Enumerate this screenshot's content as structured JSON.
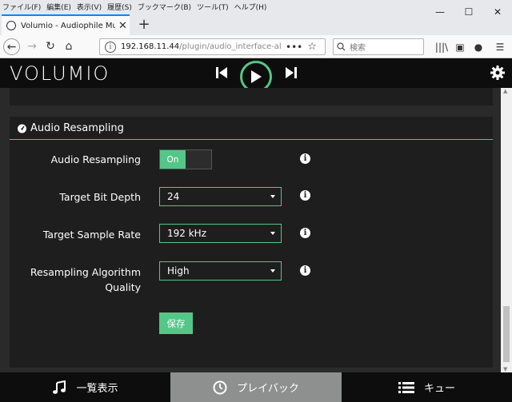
{
  "browser": {
    "menu": [
      "ファイル(F)",
      "編集(E)",
      "表示(V)",
      "履歴(S)",
      "ブックマーク(B)",
      "ツール(T)",
      "ヘルプ(H)"
    ],
    "tab_title": "Volumio - Audiophile Music Pla",
    "url_host": "192.168.11.44",
    "url_path": "/plugin/audio_interface-als",
    "search_placeholder": "検索"
  },
  "app": {
    "logo": "VOLUMIO"
  },
  "section": {
    "title": "Audio Resampling",
    "rows": {
      "resampling_label": "Audio Resampling",
      "resampling_state": "On",
      "bit_depth_label": "Target Bit Depth",
      "bit_depth_value": "24",
      "sample_rate_label": "Target Sample Rate",
      "sample_rate_value": "192 kHz",
      "quality_label_line1": "Resampling Algorithm",
      "quality_label_line2": "Quality",
      "quality_value": "High"
    },
    "save_label": "保存"
  },
  "bottom_tabs": {
    "browse": "一覧表示",
    "playback": "プレイバック",
    "queue": "キュー"
  },
  "colors": {
    "accent": "#54c688",
    "header_bg": "#0d0d0d",
    "panel_bg": "#1e1e1e",
    "active_tab": "#8e9090"
  }
}
